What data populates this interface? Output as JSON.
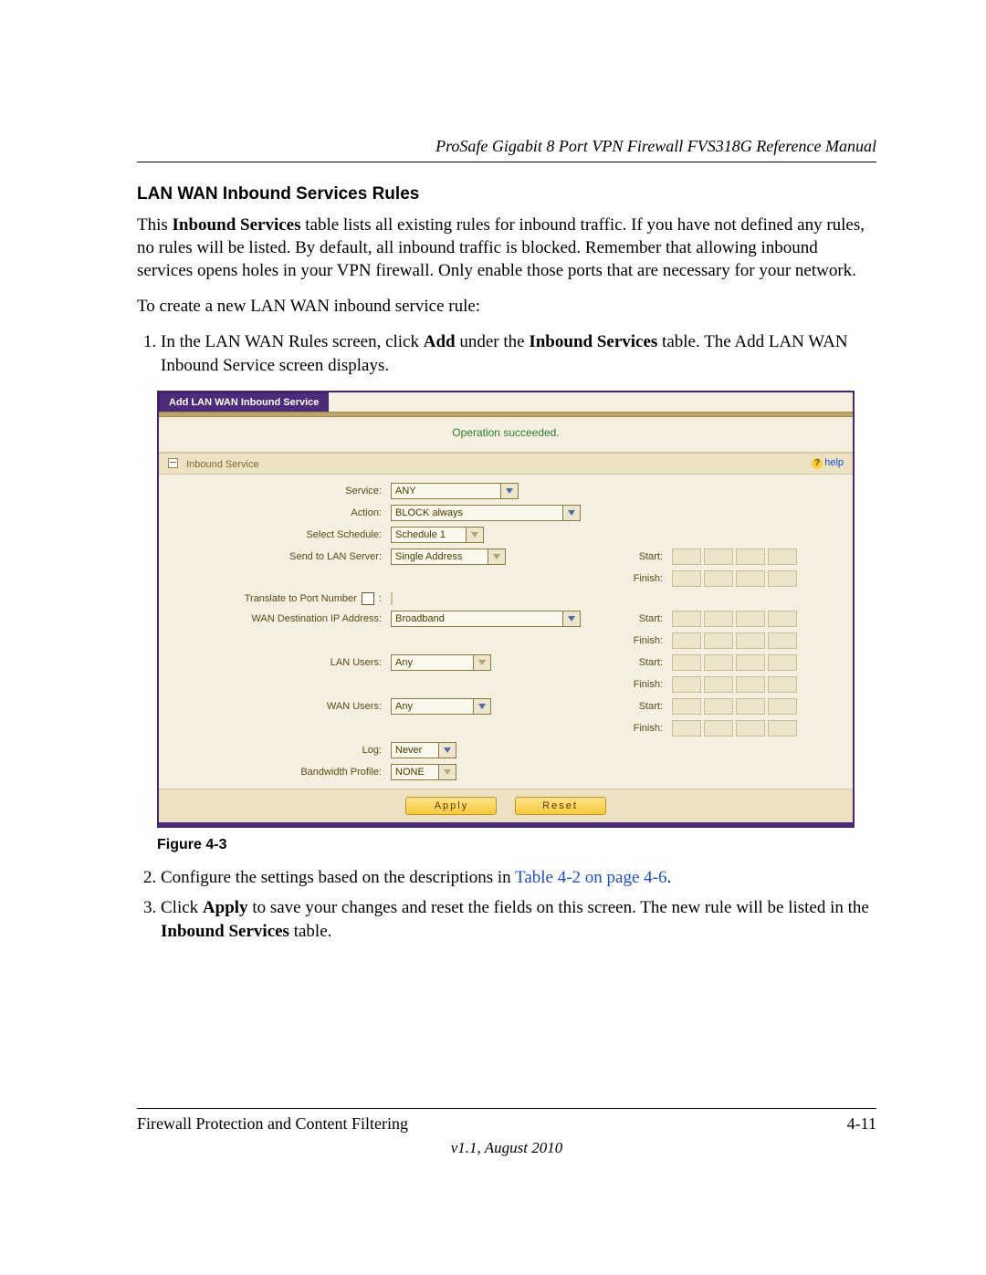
{
  "header": {
    "manual_title": "ProSafe Gigabit 8 Port VPN Firewall FVS318G Reference Manual"
  },
  "section": {
    "title": "LAN WAN Inbound Services Rules",
    "intro_before_bold": "This ",
    "intro_bold1": "Inbound Services",
    "intro_after_bold": " table lists all existing rules for inbound traffic. If you have not defined any rules, no rules will be listed. By default, all inbound traffic is blocked. Remember that allowing inbound services opens holes in your VPN firewall. Only enable those ports that are necessary for your network.",
    "lead_in": "To create a new LAN WAN inbound service rule:"
  },
  "steps": {
    "s1_a": "In the LAN WAN Rules screen, click ",
    "s1_b": "Add",
    "s1_c": " under the ",
    "s1_d": "Inbound Services",
    "s1_e": " table. The Add LAN WAN Inbound Service screen displays.",
    "s2_a": "Configure the settings based on the descriptions in ",
    "s2_link": "Table 4-2 on page 4-6",
    "s2_b": ".",
    "s3_a": "Click ",
    "s3_b": "Apply",
    "s3_c": " to save your changes and reset the fields on this screen. The new rule will be listed in the ",
    "s3_d": "Inbound Services",
    "s3_e": " table."
  },
  "figure_caption": "Figure 4-3",
  "screenshot": {
    "tab_label": "Add LAN WAN Inbound Service",
    "status": "Operation succeeded.",
    "panel_title": "Inbound Service",
    "help_label": "help",
    "labels": {
      "service": "Service:",
      "action": "Action:",
      "schedule": "Select Schedule:",
      "send_to_lan": "Send to LAN Server:",
      "translate_port": "Translate to Port Number",
      "wan_dest": "WAN Destination IP Address:",
      "lan_users": "LAN Users:",
      "wan_users": "WAN Users:",
      "log": "Log:",
      "bw_profile": "Bandwidth Profile:",
      "start": "Start:",
      "finish": "Finish:"
    },
    "values": {
      "service": "ANY",
      "action": "BLOCK always",
      "schedule": "Schedule 1",
      "send_to_lan": "Single Address",
      "wan_dest": "Broadband",
      "lan_users": "Any",
      "wan_users": "Any",
      "log": "Never",
      "bw_profile": "NONE"
    },
    "buttons": {
      "apply": "Apply",
      "reset": "Reset"
    }
  },
  "footer": {
    "chapter": "Firewall Protection and Content Filtering",
    "page": "4-11",
    "version": "v1.1, August 2010"
  }
}
